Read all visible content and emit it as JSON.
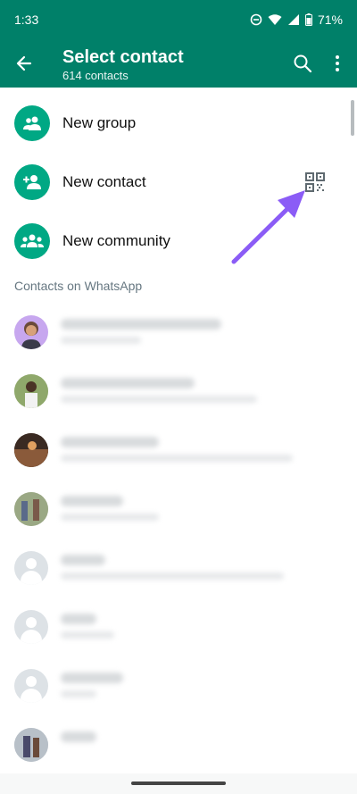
{
  "status_bar": {
    "time": "1:33",
    "battery": "71%"
  },
  "app_bar": {
    "title": "Select contact",
    "subtitle": "614 contacts"
  },
  "actions": [
    {
      "label": "New group"
    },
    {
      "label": "New contact"
    },
    {
      "label": "New community"
    }
  ],
  "section_header": "Contacts on WhatsApp",
  "colors": {
    "primary": "#008069",
    "accent": "#00A884",
    "annotation_arrow": "#8B5CF6"
  },
  "icons": [
    "back-arrow-icon",
    "search-icon",
    "more-vert-icon",
    "group-icon",
    "person-add-icon",
    "qr-code-icon",
    "community-icon",
    "dnd-icon",
    "wifi-icon",
    "signal-icon",
    "battery-icon",
    "default-avatar-icon"
  ]
}
